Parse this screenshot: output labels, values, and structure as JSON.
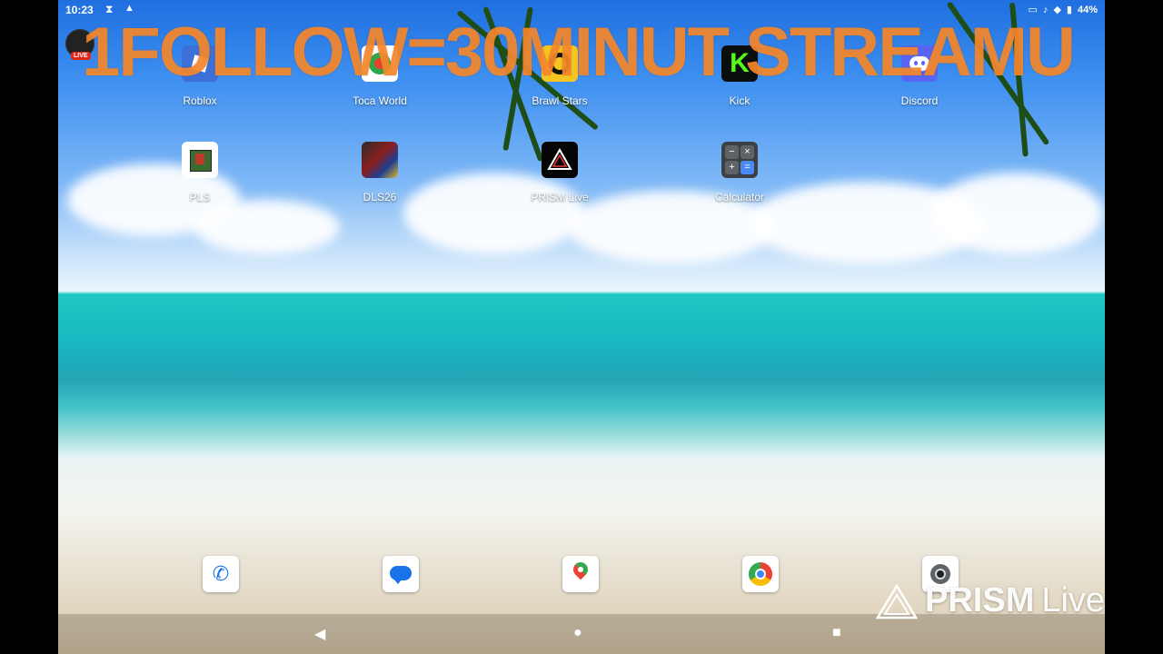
{
  "status_bar": {
    "time": "10:23",
    "battery": "44%",
    "icons": [
      "hourglass-icon",
      "alert-triangle-icon",
      "cast-icon",
      "bell-icon",
      "wifi-icon",
      "battery-icon"
    ]
  },
  "live_badge": "LIVE",
  "overlay_text": "1FOLLOW=30MINUT STREAMU",
  "apps_row1": [
    {
      "label": "Roblox",
      "icon": "roblox-icon"
    },
    {
      "label": "Toca World",
      "icon": "toca-world-icon"
    },
    {
      "label": "Brawl Stars",
      "icon": "brawl-stars-icon"
    },
    {
      "label": "Kick",
      "icon": "kick-icon",
      "glyph": "K",
      "color": "#53fc18"
    },
    {
      "label": "Discord",
      "icon": "discord-icon",
      "color": "#5865f2"
    }
  ],
  "apps_row2": [
    {
      "label": "PLS",
      "icon": "pls-icon"
    },
    {
      "label": "DLS26",
      "icon": "dls26-icon"
    },
    {
      "label": "PRISM Live",
      "icon": "prism-live-icon"
    },
    {
      "label": "Calculator",
      "icon": "calculator-icon",
      "glyphs": [
        "−",
        "×",
        "+",
        "="
      ]
    }
  ],
  "dock": [
    "phone-icon",
    "messages-icon",
    "maps-icon",
    "chrome-icon",
    "camera-icon"
  ],
  "navigation": {
    "back": "◀",
    "home": "●",
    "recents": "■"
  },
  "watermark": {
    "brand": "PRISM",
    "suffix": "Live"
  }
}
